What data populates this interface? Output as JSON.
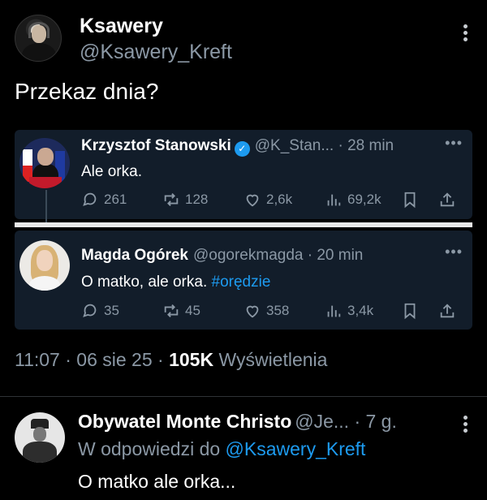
{
  "post": {
    "author_name": "Ksawery",
    "author_handle": "@Ksawery_Kreft",
    "text": "Przekaz dnia?",
    "timestamp": "11:07 · 06 sie 25 ·",
    "views_count": "105K",
    "views_label": "Wyświetlenia"
  },
  "quotes": [
    {
      "name": "Krzysztof Stanowski",
      "verified": true,
      "meta": "@K_Stan... · 28 min",
      "text": "Ale orka.",
      "hashtag": "",
      "stats": {
        "replies": "261",
        "reposts": "128",
        "likes": "2,6k",
        "views": "69,2k"
      }
    },
    {
      "name": "Magda Ogórek",
      "verified": false,
      "meta": "@ogorekmagda · 20 min",
      "text": "O matko, ale orka.",
      "hashtag": "#orędzie",
      "stats": {
        "replies": "35",
        "reposts": "45",
        "likes": "358",
        "views": "3,4k"
      }
    }
  ],
  "reply": {
    "name": "Obywatel Monte Christo",
    "meta": "@Je... · 7 g.",
    "context_prefix": "W odpowiedzi do",
    "context_mention": "@Ksawery_Kreft",
    "text": "O matko ale orka..."
  },
  "icons": {
    "more": "more-vertical-icon",
    "verified": "verified-badge-icon",
    "reply": "reply-bubble-icon",
    "repost": "repost-icon",
    "like": "heart-icon",
    "views": "views-bars-icon",
    "bookmark": "bookmark-icon",
    "share": "share-icon"
  },
  "colors": {
    "background": "#000000",
    "quote_card": "#121d2a",
    "link": "#1d9bf0",
    "muted": "#8b98a5"
  }
}
